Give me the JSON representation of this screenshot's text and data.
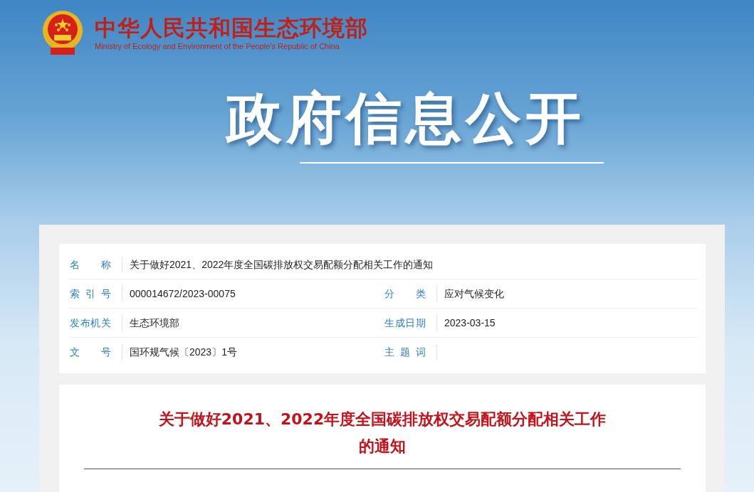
{
  "header": {
    "title": "中华人民共和国生态环境部",
    "subtitle": "Ministry of Ecology and Environment of the People's Republic of China"
  },
  "banner": {
    "title": "政府信息公开"
  },
  "info_table": {
    "rows": [
      {
        "cells": [
          {
            "label": "名称",
            "value": "关于做好2021、2022年度全国碳排放权交易配额分配相关工作的通知"
          }
        ]
      },
      {
        "cells": [
          {
            "label": "索引号",
            "value": "000014672/2023-00075"
          },
          {
            "label": "分类",
            "value": "应对气候变化"
          }
        ]
      },
      {
        "cells": [
          {
            "label": "发布机关",
            "value": "生态环境部"
          },
          {
            "label": "生成日期",
            "value": "2023-03-15"
          }
        ]
      },
      {
        "cells": [
          {
            "label": "文号",
            "value": "国环规气候〔2023〕1号"
          },
          {
            "label": "主题词"
          }
        ]
      }
    ]
  },
  "article": {
    "title_lines": [
      "关于做好2021、2022年度全国碳排放权交易配额分配相关工作",
      "的通知"
    ]
  }
}
